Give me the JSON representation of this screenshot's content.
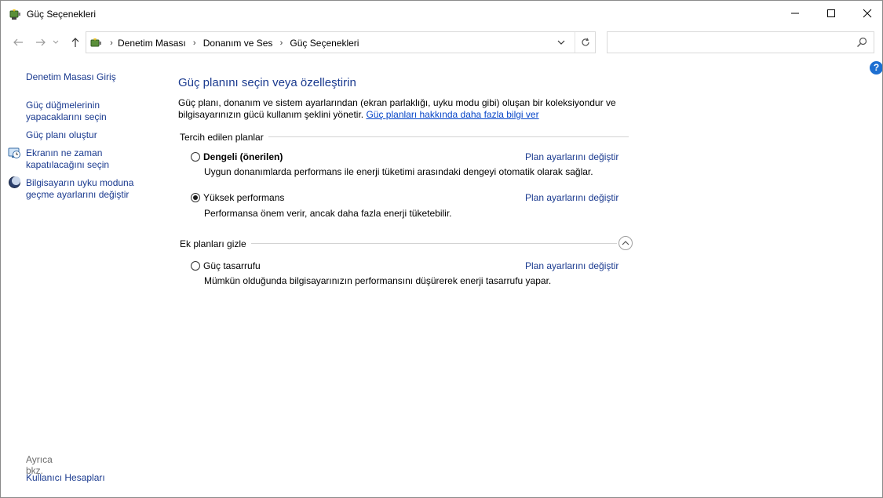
{
  "window": {
    "title": "Güç Seçenekleri",
    "minimize_icon": "minimize-icon",
    "maximize_icon": "maximize-icon",
    "close_icon": "close-icon"
  },
  "navigation": {
    "breadcrumbs": [
      "Denetim Masası",
      "Donanım ve Ses",
      "Güç Seçenekleri"
    ],
    "search_placeholder": ""
  },
  "sidebar": {
    "items": [
      {
        "label": "Denetim Masası Giriş"
      },
      {
        "label_lines": [
          "Güç düğmelerinin",
          "yapacaklarını seçin"
        ]
      },
      {
        "label": "Güç planı oluştur"
      },
      {
        "label_lines": [
          "Ekranın ne zaman",
          "kapatılacağını seçin"
        ],
        "icon": "display-clock-icon"
      },
      {
        "label_lines": [
          "Bilgisayarın uyku moduna",
          "geçme ayarlarını değiştir"
        ],
        "icon": "moon-sleep-icon"
      }
    ],
    "see_also_label": "Ayrıca bkz.",
    "see_also_items": [
      "Kullanıcı Hesapları"
    ]
  },
  "main": {
    "title": "Güç planını seçin veya özelleştirin",
    "intro_line1": "Güç planı, donanım ve sistem ayarlarından (ekran parlaklığı, uyku modu gibi) oluşan bir koleksiyondur ve",
    "intro_line2": "bilgisayarınızın gücü kullanım şeklini yönetir.",
    "intro_link": "Güç planları hakkında daha fazla bilgi ver",
    "preferred_group_label": "Tercih edilen planlar",
    "additional_group_label": "Ek planları gizle",
    "plans": [
      {
        "name": "Dengeli (önerilen)",
        "selected": false,
        "bold": true,
        "description": "Uygun donanımlarda performans ile enerji tüketimi arasındaki dengeyi otomatik olarak sağlar.",
        "link": "Plan ayarlarını değiştir"
      },
      {
        "name": "Yüksek performans",
        "selected": true,
        "bold": false,
        "description": "Performansa önem verir, ancak daha fazla enerji tüketebilir.",
        "link": "Plan ayarlarını değiştir"
      },
      {
        "name": "Güç tasarrufu",
        "selected": false,
        "bold": false,
        "description": "Mümkün olduğunda bilgisayarınızın performansını düşürerek enerji tasarrufu yapar.",
        "link": "Plan ayarlarını değiştir"
      }
    ]
  },
  "colors": {
    "link": "#1a3a8f",
    "title": "#1a3a8f",
    "help": "#1d6fd1"
  }
}
